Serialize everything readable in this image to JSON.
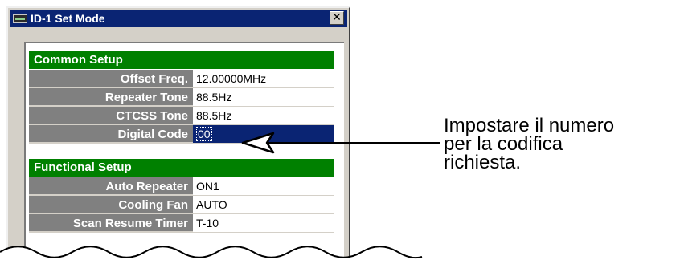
{
  "window": {
    "title": "ID-1 Set Mode",
    "close_label": "✕"
  },
  "sections": [
    {
      "title": "Common Setup",
      "rows": [
        {
          "label": "Offset Freq.",
          "value": "12.00000MHz"
        },
        {
          "label": "Repeater Tone",
          "value": "88.5Hz"
        },
        {
          "label": "CTCSS Tone",
          "value": "88.5Hz"
        },
        {
          "label": "Digital Code",
          "value": "00",
          "selected": true
        }
      ]
    },
    {
      "title": "Functional Setup",
      "rows": [
        {
          "label": "Auto Repeater",
          "value": "ON1"
        },
        {
          "label": "Cooling Fan",
          "value": "AUTO"
        },
        {
          "label": "Scan Resume Timer",
          "value": "T-10"
        }
      ]
    }
  ],
  "annotation": {
    "lines": [
      "Impostare il numero",
      "per la codifica",
      "richiesta."
    ]
  },
  "colors": {
    "titlebar": "#0a2473",
    "section_header": "#008000",
    "label_bg": "#808080",
    "selected_value_bg": "#0a2473"
  }
}
